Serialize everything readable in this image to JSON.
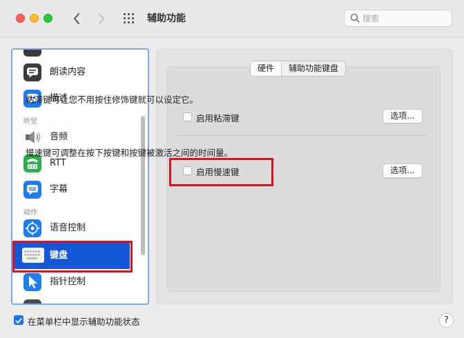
{
  "window": {
    "title": "辅助功能",
    "search_placeholder": "搜索"
  },
  "sidebar": {
    "items": [
      {
        "label": "朗读内容",
        "icon": "speech-bubble-icon"
      },
      {
        "label": "描述",
        "icon": "quote-bubble-icon"
      },
      {
        "label": "音频",
        "icon": "speaker-icon"
      },
      {
        "label": "RTT",
        "icon": "tty-phone-icon"
      },
      {
        "label": "字幕",
        "icon": "captions-icon"
      },
      {
        "label": "语音控制",
        "icon": "voice-control-icon"
      },
      {
        "label": "键盘",
        "icon": "keyboard-icon",
        "selected": true
      },
      {
        "label": "指针控制",
        "icon": "pointer-icon"
      }
    ],
    "sections": {
      "hearing": "听觉",
      "motor": "动作"
    }
  },
  "tabs": {
    "hardware": "硬件",
    "accessibility_keyboard": "辅助功能键盘"
  },
  "sticky_keys": {
    "description": "粘滞键可让您不用按住修饰键就可以设定它。",
    "checkbox_label": "启用粘滞键",
    "checked": false,
    "options_button": "选项..."
  },
  "slow_keys": {
    "description": "慢速键可调整在按下按键和按键被激活之间的时间量。",
    "checkbox_label": "启用慢速键",
    "checked": false,
    "options_button": "选项..."
  },
  "footer": {
    "show_status_label": "在菜单栏中显示辅助功能状态",
    "show_status_checked": true,
    "help_label": "?"
  },
  "colors": {
    "selection": "#1558d6",
    "highlight_red": "#e3101b",
    "sidebar_focus": "#7fa7ef"
  }
}
